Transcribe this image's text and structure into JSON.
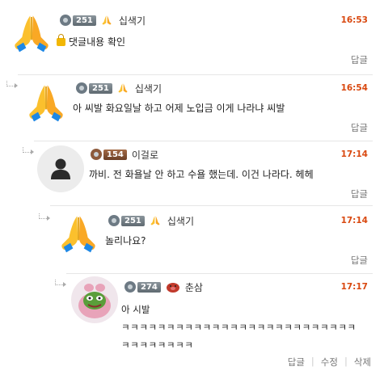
{
  "comments": [
    {
      "level": "251",
      "nickname": "십색기",
      "time": "16:53",
      "text": "댓글내용 확인",
      "locked": true,
      "reply_label": "답글",
      "avatar_icon": "praying-hands-icon"
    },
    {
      "level": "251",
      "nickname": "십색기",
      "time": "16:54",
      "text": "아 씨발 화요일날 하고 어제 노입금 이게 나라냐 씨발",
      "reply_label": "답글",
      "avatar_icon": "praying-hands-icon"
    },
    {
      "level": "154",
      "nickname": "이걸로",
      "time": "17:14",
      "text": "까비. 전 화욜날 안 하고 수욜 했는데. 이건 나라다. 헤헤",
      "reply_label": "답글",
      "avatar_icon": "default-user-icon"
    },
    {
      "level": "251",
      "nickname": "십색기",
      "time": "17:14",
      "text": "놀리나요?",
      "reply_label": "답글",
      "avatar_icon": "praying-hands-icon"
    },
    {
      "level": "274",
      "nickname": "춘삼",
      "time": "17:17",
      "text_line1": "아 시발",
      "text_line2": "ㅋㅋㅋㅋㅋㅋㅋㅋㅋㅋㅋㅋㅋㅋㅋㅋㅋㅋㅋㅋㅋㅋㅋㅋㅋㅋ",
      "text_line3": "ㅋㅋㅋㅋㅋㅋㅋㅋ",
      "actions": [
        "답글",
        "수정",
        "삭제"
      ],
      "avatar_icon": "pepe-frog-pig-icon"
    }
  ],
  "colors": {
    "time": "#d9480f",
    "separator": "#e6e6e6"
  }
}
